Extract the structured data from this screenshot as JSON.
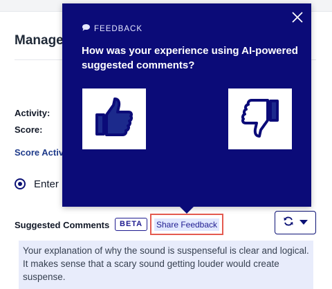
{
  "panel": {
    "title": "Manage",
    "activity_label": "Activity:",
    "score_label": "Score:",
    "score_activity_link": "Score Activ",
    "right_link_fragment": "",
    "radio_label": "Enter"
  },
  "suggested": {
    "label": "Suggested Comments",
    "beta": "BETA",
    "share_feedback": "Share Feedback",
    "comment": "Your explanation of why the sound is suspenseful is clear and logical. It makes sense that a scary sound getting louder would create suspense."
  },
  "popover": {
    "tag": "FEEDBACK",
    "question": "How was your experience using AI-powered suggested comments?"
  },
  "colors": {
    "popover_bg": "#0b0b78",
    "accent": "#1e1b8f",
    "highlight_border": "#e45a4f",
    "comment_bg": "#e8ecfb"
  },
  "icons": {
    "close": "close-icon",
    "chat": "chat-bubble-icon",
    "thumbs_up": "thumbs-up-icon",
    "thumbs_down": "thumbs-down-icon",
    "refresh": "refresh-icon",
    "caret": "caret-down-icon"
  }
}
